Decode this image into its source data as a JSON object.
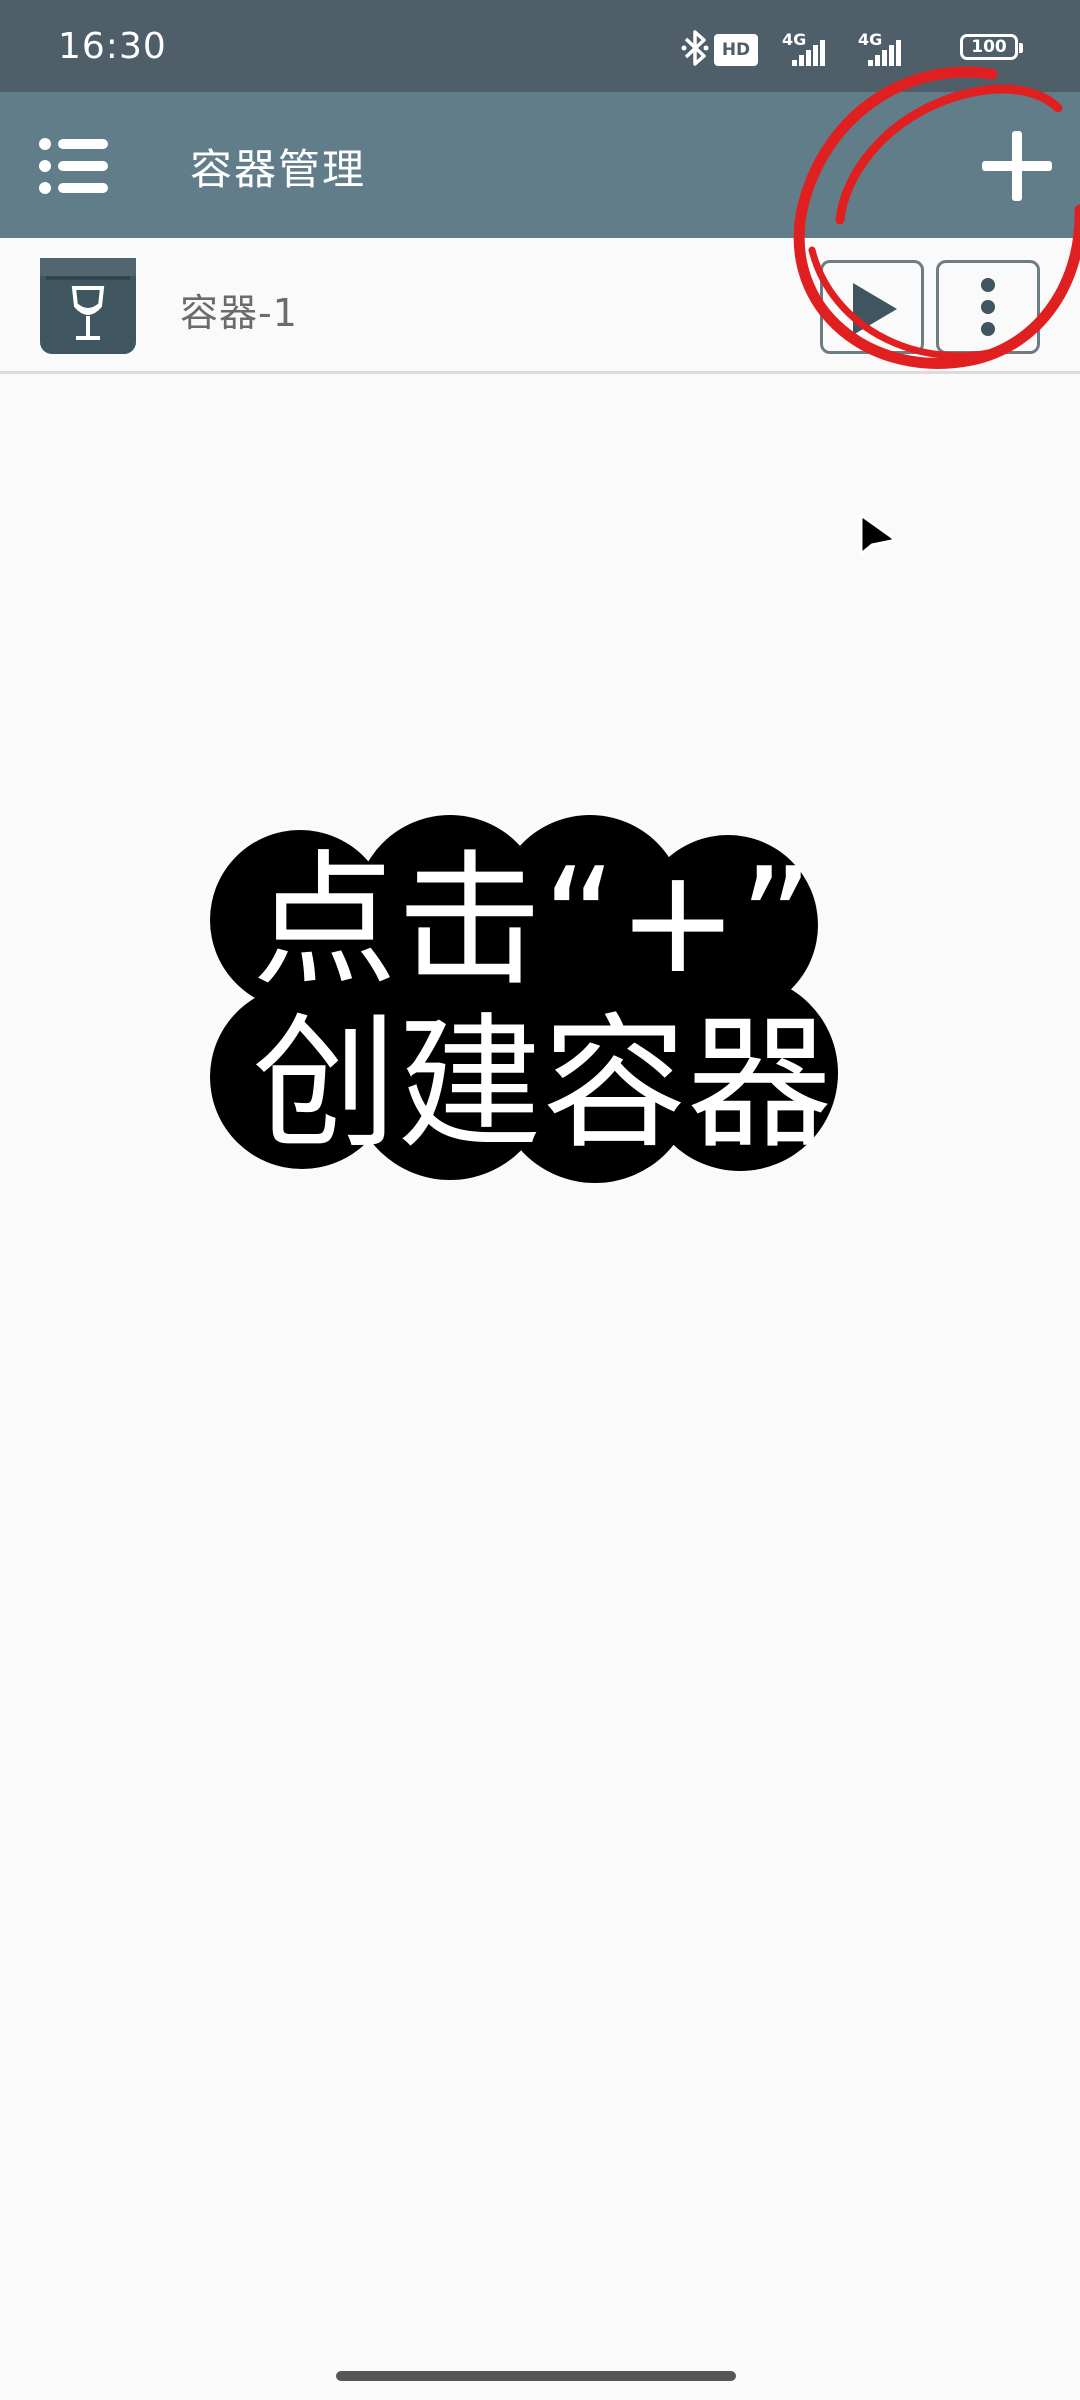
{
  "status_bar": {
    "time": "16:30",
    "hd_label": "HD",
    "network_1": "4G",
    "network_2": "4G",
    "battery": "100",
    "icons": [
      "bluetooth-icon",
      "hd-voice-icon",
      "signal-icon",
      "signal-icon",
      "battery-icon"
    ]
  },
  "app_bar": {
    "title": "容器管理",
    "menu_icon": "list-menu-icon",
    "add_icon": "plus-icon"
  },
  "containers": [
    {
      "name": "容器-1",
      "icon": "wine-glass-box-icon",
      "actions": [
        "play-icon",
        "more-vertical-icon"
      ]
    }
  ],
  "overlay": {
    "line1": "点击“+”",
    "line2": "创建容器"
  },
  "colors": {
    "status_bar": "#4f5f6a",
    "app_bar": "#627d8a",
    "background": "#fafafa",
    "annotation_red": "#e02020",
    "overlay_black": "#000000"
  }
}
